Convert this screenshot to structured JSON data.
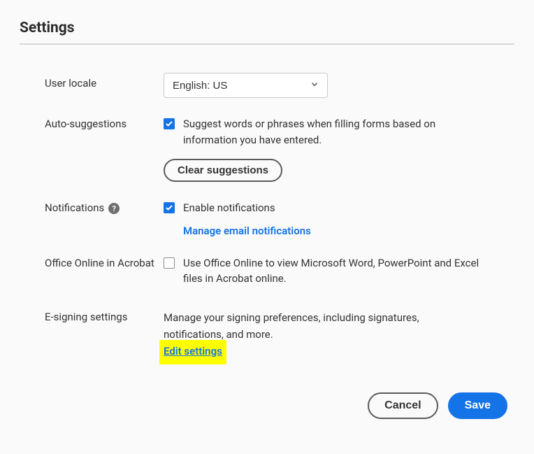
{
  "title": "Settings",
  "rows": {
    "locale": {
      "label": "User locale",
      "value": "English: US"
    },
    "auto_suggestions": {
      "label": "Auto-suggestions",
      "checked": true,
      "text": "Suggest words or phrases when filling forms based on information you have entered.",
      "clear_label": "Clear suggestions"
    },
    "notifications": {
      "label": "Notifications",
      "checked": true,
      "text": "Enable notifications",
      "manage_label": "Manage email notifications"
    },
    "office_online": {
      "label": "Office Online in Acrobat",
      "checked": false,
      "text": "Use Office Online to view Microsoft Word, PowerPoint and Excel files in Acrobat online."
    },
    "esigning": {
      "label": "E-signing settings",
      "text": "Manage your signing preferences, including signatures, notifications, and more.",
      "edit_label": "Edit settings"
    }
  },
  "footer": {
    "cancel": "Cancel",
    "save": "Save"
  }
}
